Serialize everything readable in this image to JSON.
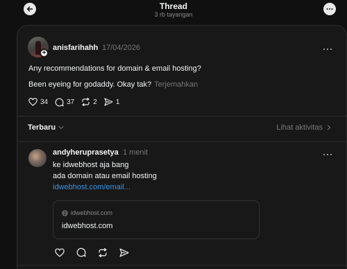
{
  "header": {
    "title": "Thread",
    "subtitle": "3 rb tayangan"
  },
  "post": {
    "username": "anisfarihahh",
    "date": "17/04/2026",
    "line1": "Any recommendations for domain & email hosting?",
    "line2": "Been eyeing for godaddy. Okay tak?",
    "translate_label": "Terjemahkan",
    "likes": "34",
    "comments": "37",
    "reposts": "2",
    "shares": "1"
  },
  "replies_bar": {
    "sort_label": "Terbaru",
    "activity_label": "Lihat aktivitas"
  },
  "reply": {
    "username": "andyheruprasetya",
    "time": "1 menit",
    "line1": "ke idwebhost aja bang",
    "line2": "ada domain atau email hosting",
    "link_text": "idwebhost.com/email...",
    "preview_domain": "idwebhost.com",
    "preview_title": "idwebhost.com"
  },
  "icons": {
    "back": "arrow-left-icon",
    "more": "more-horizontal-icon",
    "like": "heart-icon",
    "comment": "comment-icon",
    "repost": "repost-icon",
    "share": "send-icon",
    "globe": "globe-icon",
    "chevron": "chevron-icon"
  }
}
